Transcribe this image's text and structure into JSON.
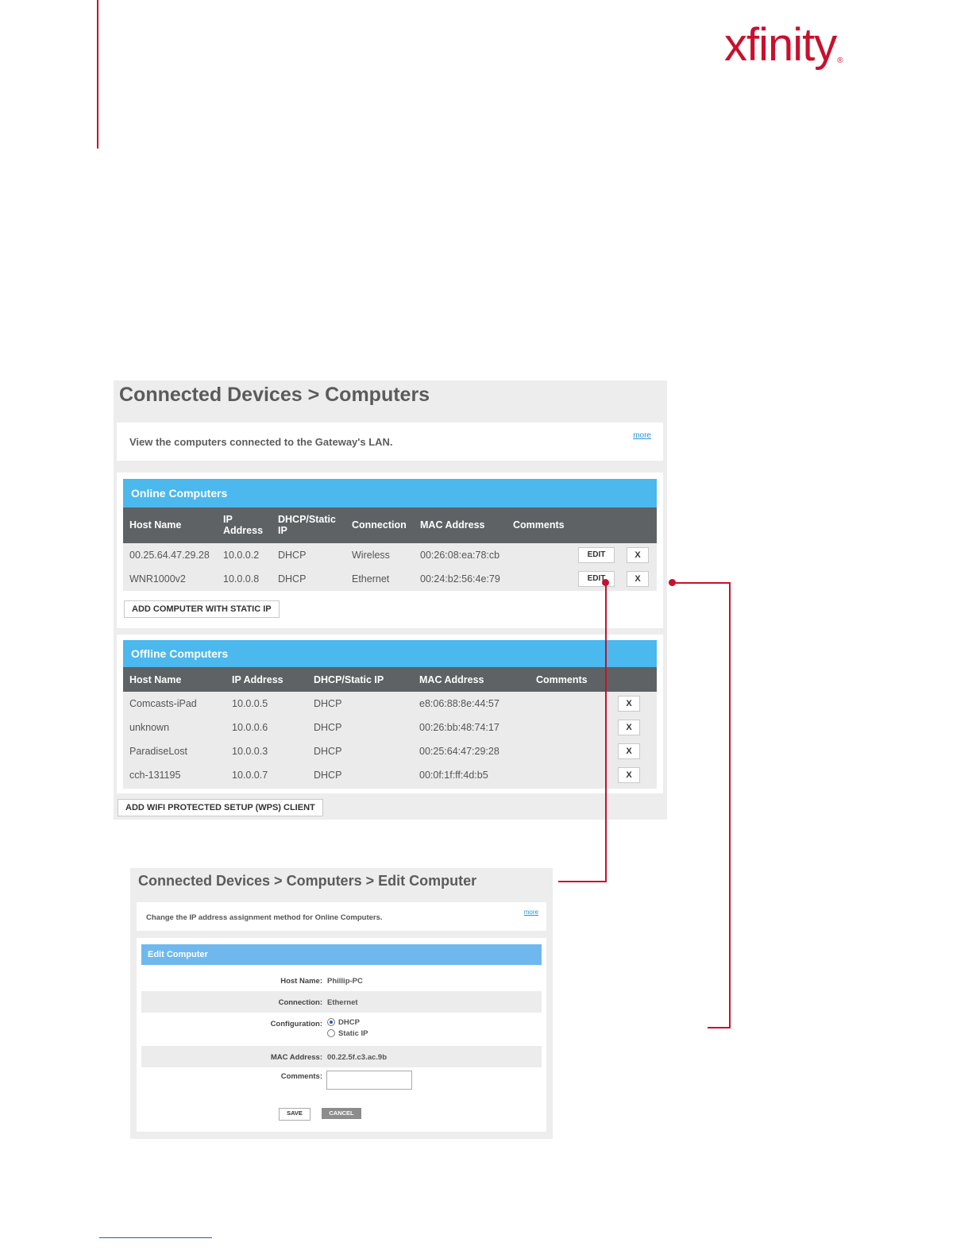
{
  "brand": {
    "logo_text": "xfinity",
    "logo_mark": "®",
    "color": "#c8102e"
  },
  "colors": {
    "section_header": "#4bb8ee",
    "column_header": "#5e6264",
    "accent_red": "#c8102e"
  },
  "main": {
    "title": "Connected Devices > Computers",
    "description": "View the computers connected to the Gateway's LAN.",
    "more_link": "more",
    "online": {
      "heading": "Online Computers",
      "columns": {
        "host_name": "Host Name",
        "ip_line1": "IP",
        "ip_line2": "Address",
        "dhcp_line1": "DHCP/Static",
        "dhcp_line2": "IP",
        "connection": "Connection",
        "mac": "MAC Address",
        "comments": "Comments"
      },
      "rows": [
        {
          "host": "00.25.64.47.29.28",
          "ip": "10.0.0.2",
          "mode": "DHCP",
          "connection": "Wireless",
          "mac": "00:26:08:ea:78:cb",
          "edit": "EDIT",
          "remove": "X"
        },
        {
          "host": "WNR1000v2",
          "ip": "10.0.0.8",
          "mode": "DHCP",
          "connection": "Ethernet",
          "mac": "00:24:b2:56:4e:79",
          "edit": "EDIT",
          "remove": "X"
        }
      ],
      "add_button": "ADD COMPUTER WITH STATIC IP"
    },
    "offline": {
      "heading": "Offline Computers",
      "columns": {
        "host_name": "Host Name",
        "ip": "IP Address",
        "dhcp": "DHCP/Static IP",
        "mac": "MAC Address",
        "comments": "Comments"
      },
      "rows": [
        {
          "host": "Comcasts-iPad",
          "ip": "10.0.0.5",
          "mode": "DHCP",
          "mac": "e8:06:88:8e:44:57",
          "remove": "X"
        },
        {
          "host": "unknown",
          "ip": "10.0.0.6",
          "mode": "DHCP",
          "mac": "00:26:bb:48:74:17",
          "remove": "X"
        },
        {
          "host": "ParadiseLost",
          "ip": "10.0.0.3",
          "mode": "DHCP",
          "mac": "00:25:64:47:29:28",
          "remove": "X"
        },
        {
          "host": "cch-131195",
          "ip": "10.0.0.7",
          "mode": "DHCP",
          "mac": "00:0f:1f:ff:4d:b5",
          "remove": "X"
        }
      ]
    },
    "wps_button": "ADD WIFI PROTECTED SETUP (WPS) CLIENT"
  },
  "edit": {
    "title": "Connected Devices > Computers > Edit Computer",
    "description": "Change the IP address assignment method for Online Computers.",
    "more_link": "more",
    "heading": "Edit Computer",
    "fields": {
      "host_label": "Host Name:",
      "host_value": "Phillip-PC",
      "connection_label": "Connection:",
      "connection_value": "Ethernet",
      "config_label": "Configuration:",
      "config_option_dhcp": "DHCP",
      "config_option_static": "Static IP",
      "config_selected": "DHCP",
      "mac_label": "MAC Address:",
      "mac_value": "00.22.5f.c3.ac.9b",
      "comments_label": "Comments:",
      "comments_value": ""
    },
    "save": "SAVE",
    "cancel": "CANCEL"
  }
}
